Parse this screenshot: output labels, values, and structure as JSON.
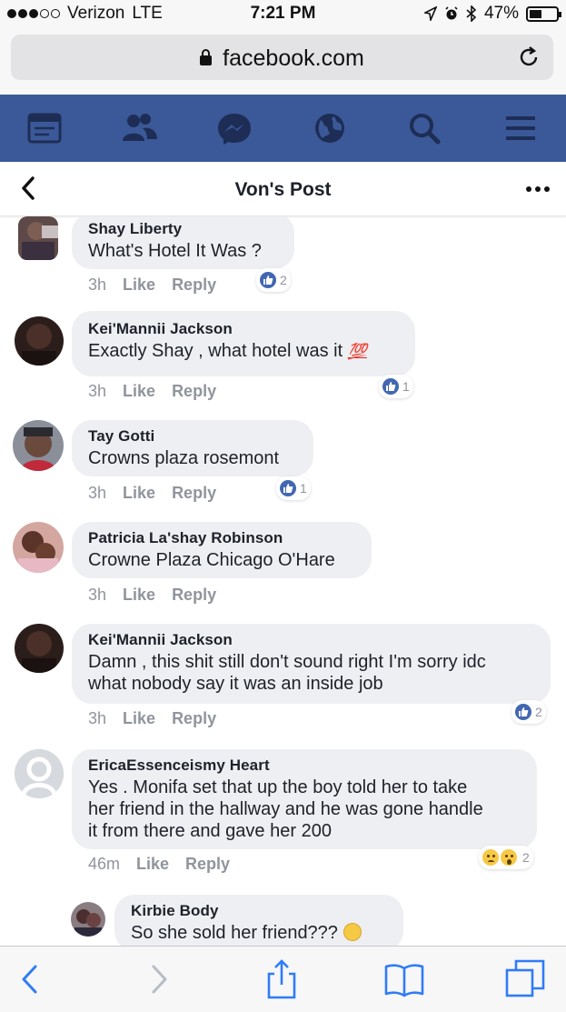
{
  "status_bar": {
    "carrier": "Verizon",
    "network": "LTE",
    "time": "7:21 PM",
    "battery": "47%",
    "battery_level": 0.47
  },
  "browser": {
    "url": "facebook.com"
  },
  "nav": {
    "icons": [
      "news-feed-icon",
      "friends-icon",
      "messenger-icon",
      "globe-icon",
      "search-icon",
      "menu-icon"
    ]
  },
  "post": {
    "title": "Von's Post"
  },
  "comments": [
    {
      "name": "Shay Liberty",
      "text": "What's Hotel It Was ?",
      "time": "3h",
      "like": "Like",
      "reply": "Reply",
      "reaction_count": "2"
    },
    {
      "name": "Kei'Mannii Jackson",
      "text": "Exactly Shay , what hotel was it",
      "emoji": "💯",
      "time": "3h",
      "like": "Like",
      "reply": "Reply",
      "reaction_count": "1"
    },
    {
      "name": "Tay Gotti",
      "text": "Crowns plaza rosemont",
      "time": "3h",
      "like": "Like",
      "reply": "Reply",
      "reaction_count": "1"
    },
    {
      "name": "Patricia La'shay Robinson",
      "text": "Crowne Plaza Chicago O'Hare",
      "time": "3h",
      "like": "Like",
      "reply": "Reply"
    },
    {
      "name": "Kei'Mannii Jackson",
      "text_lines": [
        "Damn , this shit still don't sound right I'm sorry idc",
        "what nobody say it was an inside job"
      ],
      "time": "3h",
      "like": "Like",
      "reply": "Reply",
      "reaction_count": "2"
    },
    {
      "name": "EricaEssenceismy Heart",
      "text_lines": [
        "Yes . Monifa set that up the boy told her to take",
        "her friend in the hallway and he was gone handle",
        "it from there and gave her 200"
      ],
      "time": "46m",
      "like": "Like",
      "reply": "Reply",
      "reaction_count": "2"
    },
    {
      "name": "Kirbie Body",
      "text": "So she sold her friend???"
    }
  ],
  "colors": {
    "facebook_blue": "#3b5998",
    "bubble_gray": "#eeeff2",
    "meta_gray": "#90949c",
    "like_blue": "#4267b2"
  }
}
